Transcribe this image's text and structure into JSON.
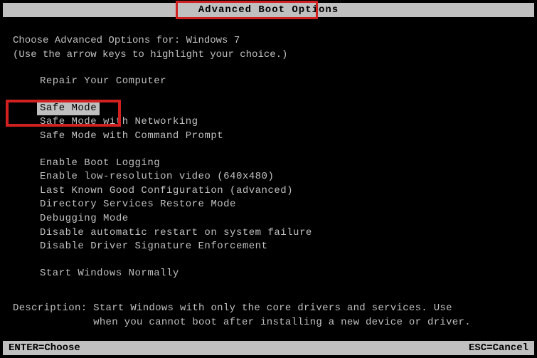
{
  "title": "Advanced Boot Options",
  "instruction_line1": "Choose Advanced Options for: Windows 7",
  "instruction_line2": "(Use the arrow keys to highlight your choice.)",
  "groups": [
    {
      "items": [
        "Repair Your Computer"
      ]
    },
    {
      "items": [
        "Safe Mode",
        "Safe Mode with Networking",
        "Safe Mode with Command Prompt"
      ]
    },
    {
      "items": [
        "Enable Boot Logging",
        "Enable low-resolution video (640x480)",
        "Last Known Good Configuration (advanced)",
        "Directory Services Restore Mode",
        "Debugging Mode",
        "Disable automatic restart on system failure",
        "Disable Driver Signature Enforcement"
      ]
    },
    {
      "items": [
        "Start Windows Normally"
      ]
    }
  ],
  "selected_option": "Safe Mode",
  "description_label": "Description:",
  "description_text_line1": "Start Windows with only the core drivers and services. Use",
  "description_text_line2": "when you cannot boot after installing a new device or driver.",
  "footer_left": "ENTER=Choose",
  "footer_right": "ESC=Cancel"
}
